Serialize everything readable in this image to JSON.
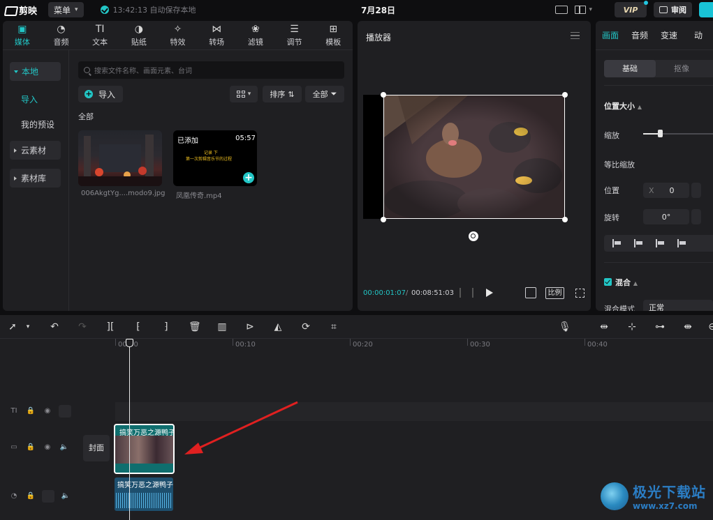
{
  "app": {
    "name": "剪映",
    "menu_label": "菜单",
    "save_status": "13:42:13 自动保存本地",
    "doc_title": "7月28日"
  },
  "header": {
    "vip_label": "VIP",
    "review_label": "审阅"
  },
  "media": {
    "tabs": [
      {
        "label": "媒体",
        "icon": "media-icon"
      },
      {
        "label": "音频",
        "icon": "audio-icon"
      },
      {
        "label": "文本",
        "icon": "text-icon"
      },
      {
        "label": "贴纸",
        "icon": "sticker-icon"
      },
      {
        "label": "特效",
        "icon": "effects-icon"
      },
      {
        "label": "转场",
        "icon": "transition-icon"
      },
      {
        "label": "滤镜",
        "icon": "filter-icon"
      },
      {
        "label": "调节",
        "icon": "adjust-icon"
      },
      {
        "label": "模板",
        "icon": "template-icon"
      }
    ],
    "nav": {
      "local": "本地",
      "import": "导入",
      "presets": "我的预设",
      "cloud": "云素材",
      "library": "素材库"
    },
    "search_placeholder": "搜索文件名称、画面元素、台词",
    "import_label": "导入",
    "sort_label": "排序",
    "filter_label": "全部",
    "section_label": "全部",
    "items": [
      {
        "filename": "006AkgtYg....modo9.jpg"
      },
      {
        "filename": "凤凰传奇.mp4",
        "badge": "已添加",
        "duration": "05:57",
        "caption_line1": "记录  下",
        "caption_line2": "第一次剪辑音乐节的过程"
      }
    ]
  },
  "player": {
    "title": "播放器",
    "current_time": "00:00:01:07",
    "separator": "/",
    "total_time": "00:08:51:03",
    "ratio_label": "比例"
  },
  "properties": {
    "tabs": [
      "画面",
      "音频",
      "变速",
      "动"
    ],
    "segments": [
      "基础",
      "抠像"
    ],
    "position_size_heading": "位置大小",
    "scale_label": "缩放",
    "uniform_scale_label": "等比缩放",
    "position_label": "位置",
    "position_x_label": "X",
    "position_x_value": "0",
    "rotation_label": "旋转",
    "rotation_value": "0°",
    "blend_heading": "混合",
    "blend_mode_label": "混合模式",
    "blend_mode_value": "正常"
  },
  "timeline": {
    "ruler": [
      "00:00",
      "00:10",
      "00:20",
      "00:30",
      "00:40"
    ],
    "cover_label": "封面",
    "video_clip_title": "搞笑万恶之源鸭子",
    "audio_clip_title": "搞笑万恶之源鸭子"
  },
  "watermark": {
    "name": "极光下载站",
    "url": "www.xz7.com"
  },
  "colors": {
    "accent": "#22c6c6",
    "panel": "#1f1f22",
    "bg": "#0e0e10",
    "arrow": "#e02020"
  }
}
